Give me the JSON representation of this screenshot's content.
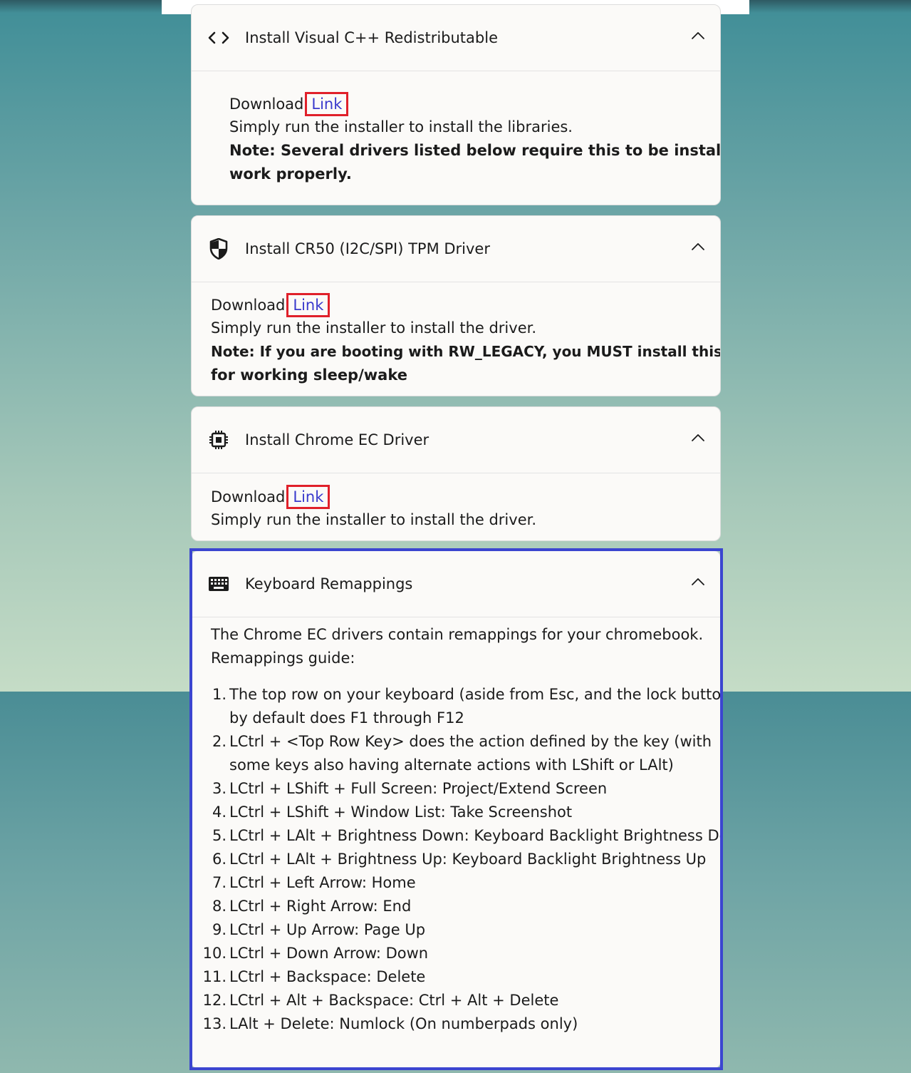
{
  "cards": [
    {
      "title": "Install Visual C++ Redistributable",
      "icon": "code-icon",
      "download_label": "Download",
      "link_label": "Link",
      "description": "Simply run the installer to install the libraries.",
      "note_line1": "Note: Several drivers listed below require this to be installed to",
      "note_line2": "work properly."
    },
    {
      "title": "Install CR50 (I2C/SPI) TPM Driver",
      "icon": "shield-icon",
      "download_label": "Download",
      "link_label": "Link",
      "description": "Simply run the installer to install the driver.",
      "note_line1": "Note: If you are booting with RW_LEGACY, you MUST install this driver",
      "note_line2": "for working sleep/wake"
    },
    {
      "title": "Install Chrome EC Driver",
      "icon": "chip-icon",
      "download_label": "Download",
      "link_label": "Link",
      "description": "Simply run the installer to install the driver."
    },
    {
      "title": "Keyboard Remappings",
      "icon": "keyboard-icon",
      "intro_line1": "The Chrome EC drivers contain remappings for your chromebook.",
      "intro_line2": "Remappings guide:",
      "items": [
        {
          "num": "1.",
          "line1": "The top row on your keyboard (aside from Esc, and the lock button)",
          "line2": "by default does F1 through F12"
        },
        {
          "num": "2.",
          "line1": "LCtrl + <Top Row Key> does the action defined by the key (with",
          "line2": "some keys also having alternate actions with LShift or LAlt)"
        },
        {
          "num": "3.",
          "line1": "LCtrl + LShift + Full Screen: Project/Extend Screen"
        },
        {
          "num": "4.",
          "line1": "LCtrl + LShift + Window List: Take Screenshot"
        },
        {
          "num": "5.",
          "line1": "LCtrl + LAlt + Brightness Down: Keyboard Backlight Brightness Down"
        },
        {
          "num": "6.",
          "line1": "LCtrl + LAlt + Brightness Up: Keyboard Backlight Brightness Up"
        },
        {
          "num": "7.",
          "line1": "LCtrl + Left Arrow: Home"
        },
        {
          "num": "8.",
          "line1": "LCtrl + Right Arrow: End"
        },
        {
          "num": "9.",
          "line1": "LCtrl + Up Arrow: Page Up"
        },
        {
          "num": "10.",
          "line1": "LCtrl + Down Arrow: Down"
        },
        {
          "num": "11.",
          "line1": "LCtrl + Backspace: Delete"
        },
        {
          "num": "12.",
          "line1": "LCtrl + Alt + Backspace: Ctrl + Alt + Delete"
        },
        {
          "num": "13.",
          "line1": "LAlt + Delete: Numlock (On numberpads only)"
        }
      ]
    }
  ],
  "colors": {
    "link": "#3a3acc",
    "link_highlight": "#e0202a",
    "section_highlight": "#3b45d0",
    "card_bg": "#fbfaf8"
  }
}
